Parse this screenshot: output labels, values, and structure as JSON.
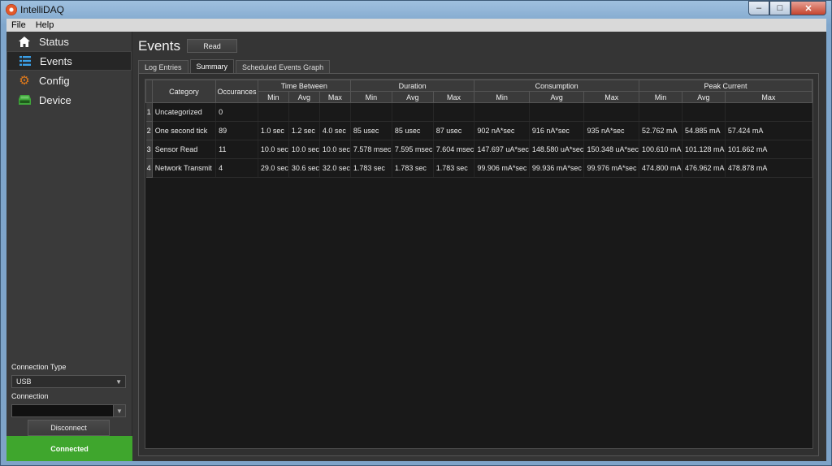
{
  "window": {
    "title": "IntelliDAQ",
    "controls": [
      "–",
      "□",
      "✕"
    ]
  },
  "menu": [
    "File",
    "Help"
  ],
  "sidebar": {
    "items": [
      {
        "label": "Status",
        "icon": "home-icon"
      },
      {
        "label": "Events",
        "icon": "list-icon"
      },
      {
        "label": "Config",
        "icon": "gear-icon"
      },
      {
        "label": "Device",
        "icon": "device-icon"
      }
    ],
    "active": "Events",
    "connection_type_label": "Connection Type",
    "connection_type_value": "USB",
    "connection_label": "Connection",
    "connection_value": "",
    "disconnect_label": "Disconnect",
    "status_text": "Connected",
    "status_color": "#3fa62d"
  },
  "main": {
    "title": "Events",
    "read_label": "Read",
    "tabs": [
      "Log Entries",
      "Summary",
      "Scheduled Events Graph"
    ],
    "active_tab": "Summary"
  },
  "table": {
    "group_headers": {
      "category": "Category",
      "occurances": "Occurances",
      "time_between": "Time Between",
      "duration": "Duration",
      "consumption": "Consumption",
      "peak_current": "Peak Current"
    },
    "sub_headers": [
      "Min",
      "Avg",
      "Max"
    ],
    "rows": [
      {
        "num": "1",
        "cells": [
          "Uncategorized",
          "0",
          "",
          "",
          "",
          "",
          "",
          "",
          "",
          "",
          "",
          "",
          "",
          ""
        ]
      },
      {
        "num": "2",
        "cells": [
          "One second tick",
          "89",
          "1.0 sec",
          "1.2 sec",
          "4.0 sec",
          "85 usec",
          "85 usec",
          "87 usec",
          "902 nA*sec",
          "916 nA*sec",
          "935 nA*sec",
          "52.762 mA",
          "54.885 mA",
          "57.424 mA"
        ]
      },
      {
        "num": "3",
        "cells": [
          "Sensor Read",
          "11",
          "10.0 sec",
          "10.0 sec",
          "10.0 sec",
          "7.578 msec",
          "7.595 msec",
          "7.604 msec",
          "147.697 uA*sec",
          "148.580 uA*sec",
          "150.348 uA*sec",
          "100.610 mA",
          "101.128 mA",
          "101.662 mA"
        ]
      },
      {
        "num": "4",
        "cells": [
          "Network Transmit",
          "4",
          "29.0 sec",
          "30.6 sec",
          "32.0 sec",
          "1.783 sec",
          "1.783 sec",
          "1.783 sec",
          "99.906 mA*sec",
          "99.936 mA*sec",
          "99.976 mA*sec",
          "474.800 mA",
          "476.962 mA",
          "478.878 mA"
        ]
      }
    ]
  }
}
